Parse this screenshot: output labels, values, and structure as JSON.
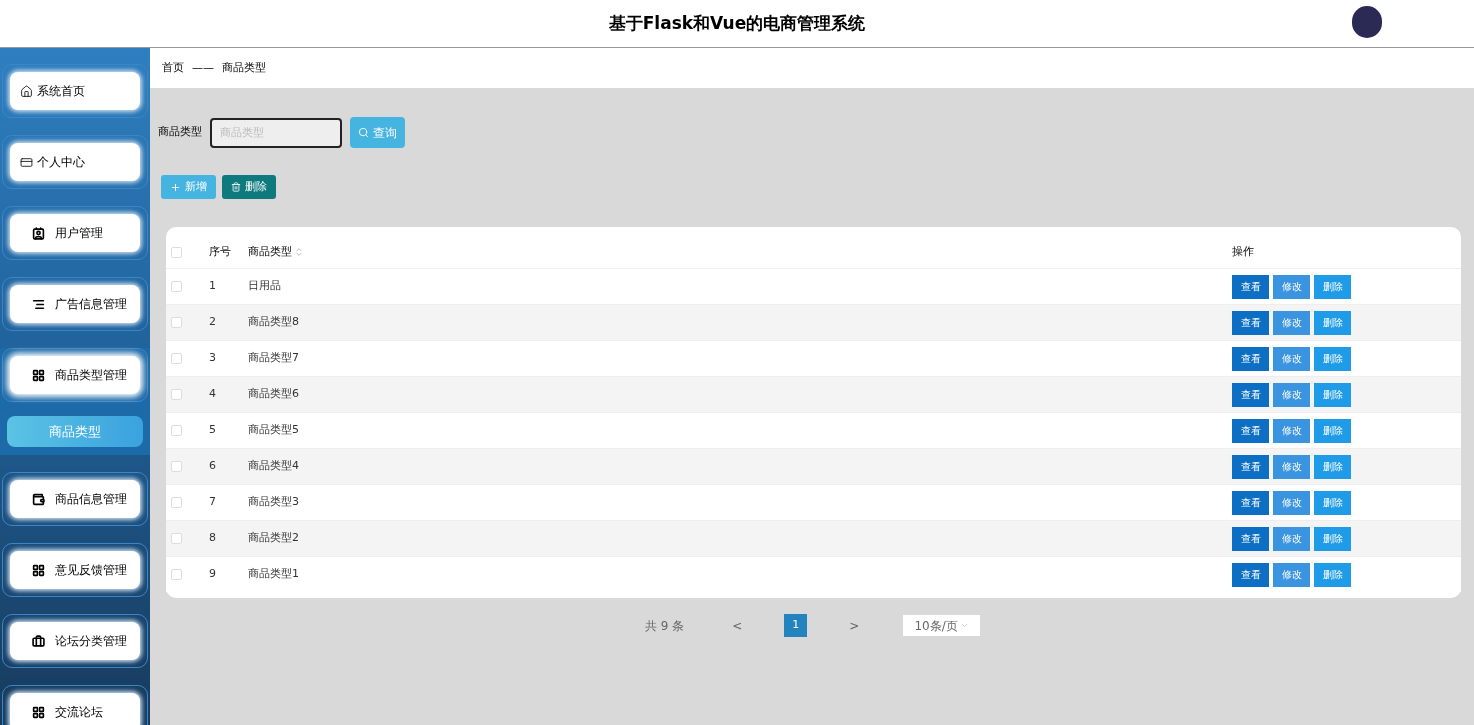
{
  "header": {
    "title": "基于Flask和Vue的电商管理系统"
  },
  "sidebar": {
    "items": [
      {
        "label": "系统首页",
        "expanded": false
      },
      {
        "label": "个人中心",
        "expanded": false
      },
      {
        "label": "用户管理",
        "expanded": false
      },
      {
        "label": "广告信息管理",
        "expanded": false
      },
      {
        "label": "商品类型管理",
        "expanded": true,
        "children": [
          {
            "label": "商品类型",
            "selected": true
          }
        ]
      },
      {
        "label": "商品信息管理",
        "expanded": false
      },
      {
        "label": "意见反馈管理",
        "expanded": false
      },
      {
        "label": "论坛分类管理",
        "expanded": false
      },
      {
        "label": "交流论坛",
        "expanded": false
      }
    ]
  },
  "breadcrumb": [
    "首页",
    "——",
    "商品类型"
  ],
  "search": {
    "label": "商品类型",
    "placeholder": "商品类型",
    "button": "查询"
  },
  "actions": [
    {
      "label": "新增",
      "kind": "add"
    },
    {
      "label": "删除",
      "kind": "delete"
    }
  ],
  "table": {
    "columns": [
      "序号",
      "商品类型",
      "操作"
    ],
    "all_checked": false,
    "rows": [
      {
        "index": "1",
        "name": "日用品",
        "checked": false,
        "actions": [
          {
            "label": "查看",
            "kind": "view"
          },
          {
            "label": "修改",
            "kind": "edit"
          },
          {
            "label": "删除",
            "kind": "delete"
          }
        ]
      },
      {
        "index": "2",
        "name": "商品类型8",
        "checked": false,
        "actions": [
          {
            "label": "查看",
            "kind": "view"
          },
          {
            "label": "修改",
            "kind": "edit"
          },
          {
            "label": "删除",
            "kind": "delete"
          }
        ]
      },
      {
        "index": "3",
        "name": "商品类型7",
        "checked": false,
        "actions": [
          {
            "label": "查看",
            "kind": "view"
          },
          {
            "label": "修改",
            "kind": "edit"
          },
          {
            "label": "删除",
            "kind": "delete"
          }
        ]
      },
      {
        "index": "4",
        "name": "商品类型6",
        "checked": false,
        "actions": [
          {
            "label": "查看",
            "kind": "view"
          },
          {
            "label": "修改",
            "kind": "edit"
          },
          {
            "label": "删除",
            "kind": "delete"
          }
        ]
      },
      {
        "index": "5",
        "name": "商品类型5",
        "checked": false,
        "actions": [
          {
            "label": "查看",
            "kind": "view"
          },
          {
            "label": "修改",
            "kind": "edit"
          },
          {
            "label": "删除",
            "kind": "delete"
          }
        ]
      },
      {
        "index": "6",
        "name": "商品类型4",
        "checked": false,
        "actions": [
          {
            "label": "查看",
            "kind": "view"
          },
          {
            "label": "修改",
            "kind": "edit"
          },
          {
            "label": "删除",
            "kind": "delete"
          }
        ]
      },
      {
        "index": "7",
        "name": "商品类型3",
        "checked": false,
        "actions": [
          {
            "label": "查看",
            "kind": "view"
          },
          {
            "label": "修改",
            "kind": "edit"
          },
          {
            "label": "删除",
            "kind": "delete"
          }
        ]
      },
      {
        "index": "8",
        "name": "商品类型2",
        "checked": false,
        "actions": [
          {
            "label": "查看",
            "kind": "view"
          },
          {
            "label": "修改",
            "kind": "edit"
          },
          {
            "label": "删除",
            "kind": "delete"
          }
        ]
      },
      {
        "index": "9",
        "name": "商品类型1",
        "checked": false,
        "actions": [
          {
            "label": "查看",
            "kind": "view"
          },
          {
            "label": "修改",
            "kind": "edit"
          },
          {
            "label": "删除",
            "kind": "delete"
          }
        ]
      }
    ]
  },
  "pagination": {
    "total": "共 9 条",
    "prev": "<",
    "pages": [
      {
        "label": "1",
        "selected": true
      }
    ],
    "next": ">",
    "page_size": "10条/页"
  }
}
